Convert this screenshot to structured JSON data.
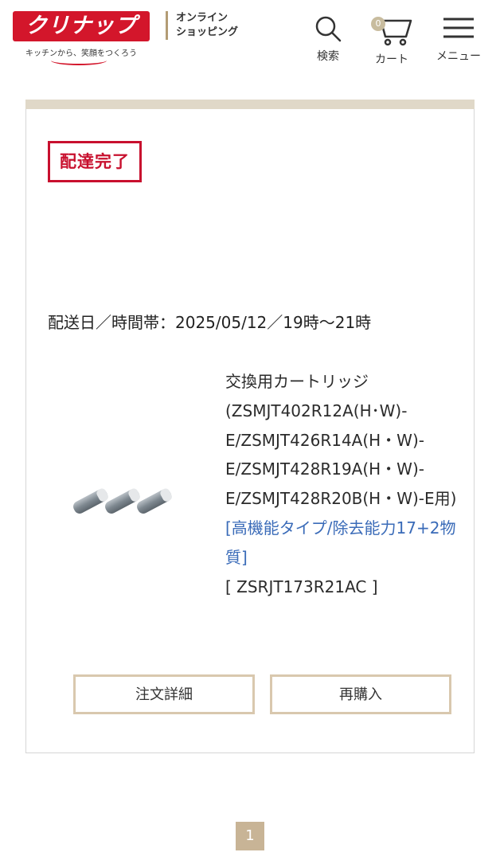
{
  "header": {
    "logo_text": "クリナップ",
    "tagline": "キッチンから、笑顔をつくろう",
    "shop_label_line1": "オンライン",
    "shop_label_line2": "ショッピング",
    "search_label": "検索",
    "cart_label": "カート",
    "cart_count": "0",
    "menu_label": "メニュー"
  },
  "order": {
    "status": "配達完了",
    "delivery_date": "配送日／時間帯：2025/05/12／19時〜21時",
    "product": {
      "name": "交換用カートリッジ(ZSMJT402R12A(H･W)-E/ZSMJT426R14A(H・W)-E/ZSMJT428R19A(H・W)-E/ZSMJT428R20B(H・W)-E用)",
      "feature": "[高機能タイプ/除去能力17+2物質]",
      "code": "[ ZSRJT173R21AC ]"
    },
    "buttons": {
      "detail": "注文詳細",
      "rebuy": "再購入"
    }
  },
  "pagination": {
    "current_page": "1"
  },
  "colors": {
    "brand_red": "#d3162b",
    "status_red": "#c8102e",
    "accent_beige": "#d9c8ae",
    "link_blue": "#3a6bb8"
  }
}
